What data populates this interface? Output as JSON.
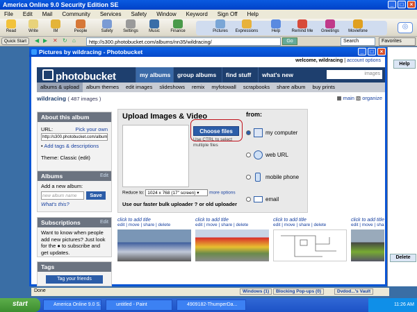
{
  "aol": {
    "title": "America Online 9.0 Security Edition SE",
    "menu": [
      "File",
      "Edit",
      "Mail",
      "Community",
      "Services",
      "Safety",
      "Window",
      "Keyword",
      "Sign Off",
      "Help"
    ],
    "toolbar": [
      {
        "label": "Read",
        "icon": "mail-read-icon"
      },
      {
        "label": "Write",
        "icon": "mail-write-icon"
      },
      {
        "label": "IM",
        "icon": "im-icon"
      },
      {
        "label": "People",
        "icon": "people-icon"
      },
      {
        "label": "Safety",
        "icon": "safety-icon"
      },
      {
        "label": "Settings",
        "icon": "settings-icon"
      },
      {
        "label": "Music",
        "icon": "music-icon"
      },
      {
        "label": "Finance",
        "icon": "finance-icon"
      }
    ],
    "toolbar2": [
      {
        "label": "Pictures",
        "icon": "pictures-icon"
      },
      {
        "label": "Expressions",
        "icon": "expressions-icon"
      },
      {
        "label": "Help",
        "icon": "help-icon"
      },
      {
        "label": "Remind Me",
        "icon": "remind-me-icon"
      },
      {
        "label": "Greetings",
        "icon": "greetings-icon"
      },
      {
        "label": "Moviefone",
        "icon": "moviefone-icon"
      }
    ],
    "quickstart": "Quick Start",
    "url": "http://s300.photobucket.com/albums/nn35/wildracing/",
    "go": "Go",
    "search": "Search",
    "favorites": "Favorites",
    "help_btn": "Help",
    "delete_btn": "Delete"
  },
  "child": {
    "title": "Pictures by wildracing - Photobucket",
    "status": "Done",
    "bottom_bar": [
      "Windows (1)",
      "Blocking Pop-ups (0)",
      "Dvdod...'s Vault"
    ]
  },
  "pb": {
    "welcome": "welcome, wildracing",
    "account": "account options",
    "logo": "photobucket",
    "nav": [
      "my albums",
      "group albums",
      "find stuff",
      "what's new"
    ],
    "search_placeholder": "images",
    "subnav": [
      "albums & upload",
      "album themes",
      "edit images",
      "slideshows",
      "remix",
      "myfotowall",
      "scrapbooks",
      "share album",
      "buy prints"
    ],
    "user": "wildracing",
    "count": "( 487 images )",
    "view_main": "main",
    "view_organize": "organize",
    "about": {
      "title": "About this album",
      "url_label": "URL:",
      "pick": "Pick your own",
      "url_value": "http://s300.photobucket.com/album",
      "tags": "Add tags & descriptions",
      "theme": "Theme: Classic (edit)"
    },
    "albums": {
      "title": "Albums",
      "edit": "Edit",
      "add_label": "Add a new album:",
      "placeholder": "new album name",
      "save": "Save",
      "whats_this": "What's this?"
    },
    "subs": {
      "title": "Subscriptions",
      "edit": "Edit",
      "text": "Want to know when people add new pictures? Just look for the ● to subscribe and get updates."
    },
    "tags": {
      "title": "Tags",
      "button": "Tag your friends"
    },
    "upload": {
      "title": "Upload Images & Video",
      "choose": "Choose files",
      "hint": "Use CTRL to select multiple files",
      "reduce_label": "Reduce to:",
      "reduce_value": "1024 x 768 (17\" screen)",
      "more": "more options",
      "bulk": "Use our faster bulk uploader ? or old uploader",
      "from": "from:",
      "sources": [
        "my computer",
        "web URL",
        "mobile phone",
        "email"
      ]
    },
    "thumbs": {
      "title": "click to add title",
      "actions": "edit | move | share | delete"
    }
  },
  "taskbar": {
    "start": "start",
    "tasks": [
      "America Online 9.0 S...",
      "untitled - Paint",
      "4909182-ThumperDa..."
    ],
    "time": "11:26 AM"
  }
}
